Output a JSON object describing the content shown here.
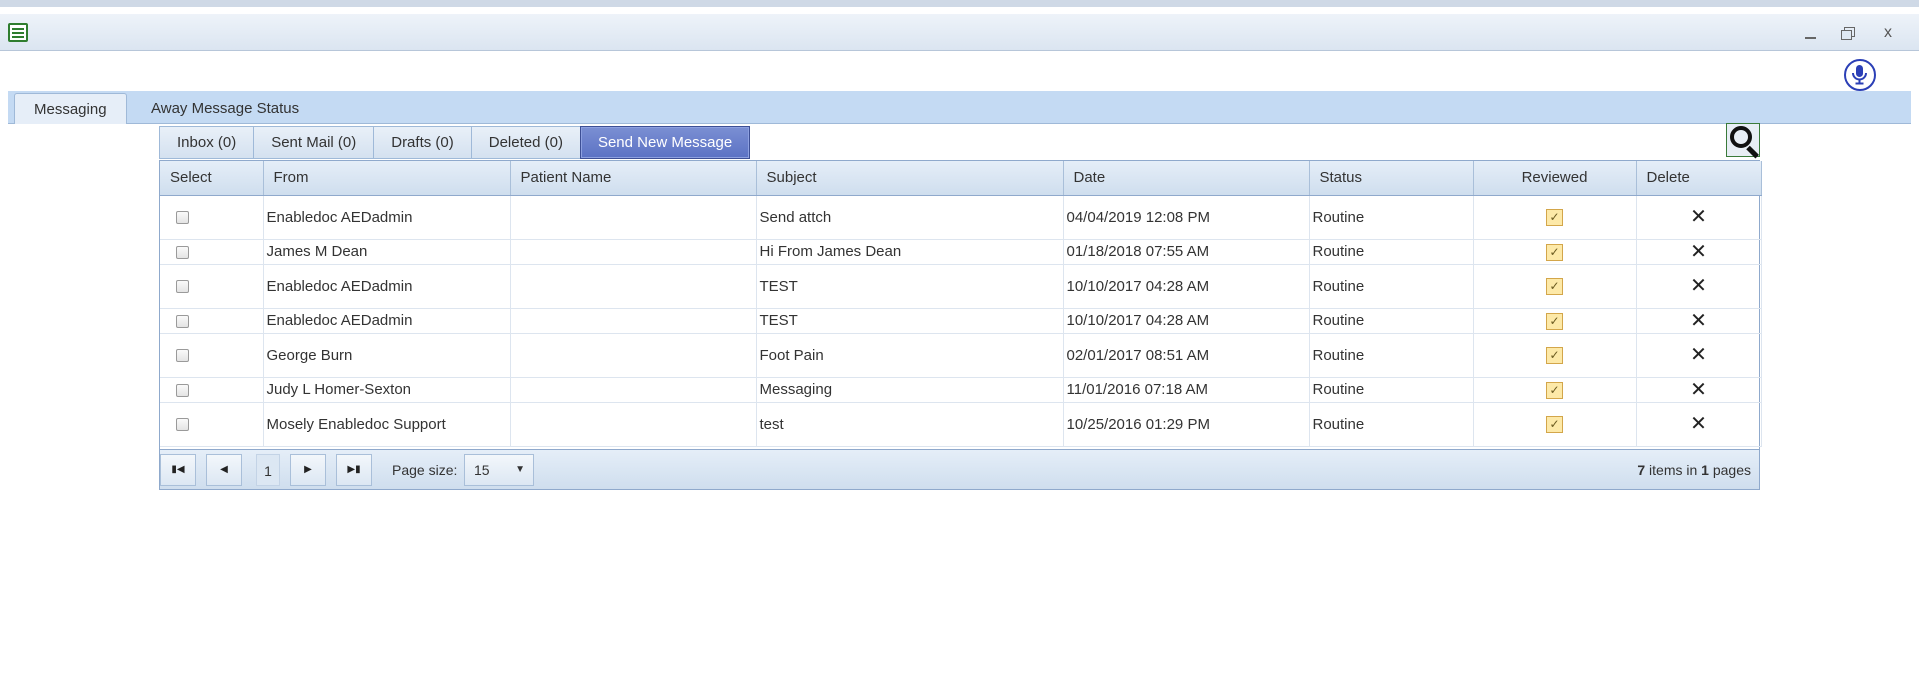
{
  "window": {
    "icon": "app-window-icon",
    "controls": {
      "minimize": "minimize-icon",
      "maximize": "restore-icon",
      "close": "x"
    }
  },
  "top_tabs": [
    {
      "label": "Messaging",
      "active": true
    },
    {
      "label": "Away Message Status",
      "active": false
    }
  ],
  "sub_tabs": [
    {
      "label": "Inbox (0)"
    },
    {
      "label": "Sent Mail (0)"
    },
    {
      "label": "Drafts (0)"
    },
    {
      "label": "Deleted (0)"
    },
    {
      "label": "Send New Message"
    }
  ],
  "grid": {
    "columns": [
      "Select",
      "From",
      "Patient Name",
      "Subject",
      "Date",
      "Status",
      "Reviewed",
      "Delete"
    ],
    "rows": [
      {
        "from": "Enabledoc AEDadmin",
        "patient": "",
        "subject": "Send attch",
        "date": "04/04/2019 12:08 PM",
        "status": "Routine",
        "reviewed": true
      },
      {
        "from": "James M Dean",
        "patient": "",
        "subject": "Hi From James Dean",
        "date": "01/18/2018 07:55 AM",
        "status": "Routine",
        "reviewed": true
      },
      {
        "from": "Enabledoc AEDadmin",
        "patient": "",
        "subject": "TEST",
        "date": "10/10/2017 04:28 AM",
        "status": "Routine",
        "reviewed": true
      },
      {
        "from": "Enabledoc AEDadmin",
        "patient": "",
        "subject": "TEST",
        "date": "10/10/2017 04:28 AM",
        "status": "Routine",
        "reviewed": true
      },
      {
        "from": "George Burn",
        "patient": "",
        "subject": "Foot Pain",
        "date": "02/01/2017 08:51 AM",
        "status": "Routine",
        "reviewed": true
      },
      {
        "from": "Judy L Homer-Sexton",
        "patient": "",
        "subject": "Messaging",
        "date": "11/01/2016 07:18 AM",
        "status": "Routine",
        "reviewed": true
      },
      {
        "from": "Mosely Enabledoc Support",
        "patient": "",
        "subject": "test",
        "date": "10/25/2016 01:29 PM",
        "status": "Routine",
        "reviewed": true
      }
    ]
  },
  "pager": {
    "current_page": "1",
    "page_size_label": "Page size:",
    "page_size": "15",
    "items_count": "7",
    "items_in_text": "items in",
    "pages_count": "1",
    "pages_text": "pages"
  },
  "colors": {
    "tab_strip": "#c4daf3",
    "primary_button": "#5b72c4",
    "mic_icon": "#2b3fb6",
    "reviewed_check": "#fde9a8"
  }
}
